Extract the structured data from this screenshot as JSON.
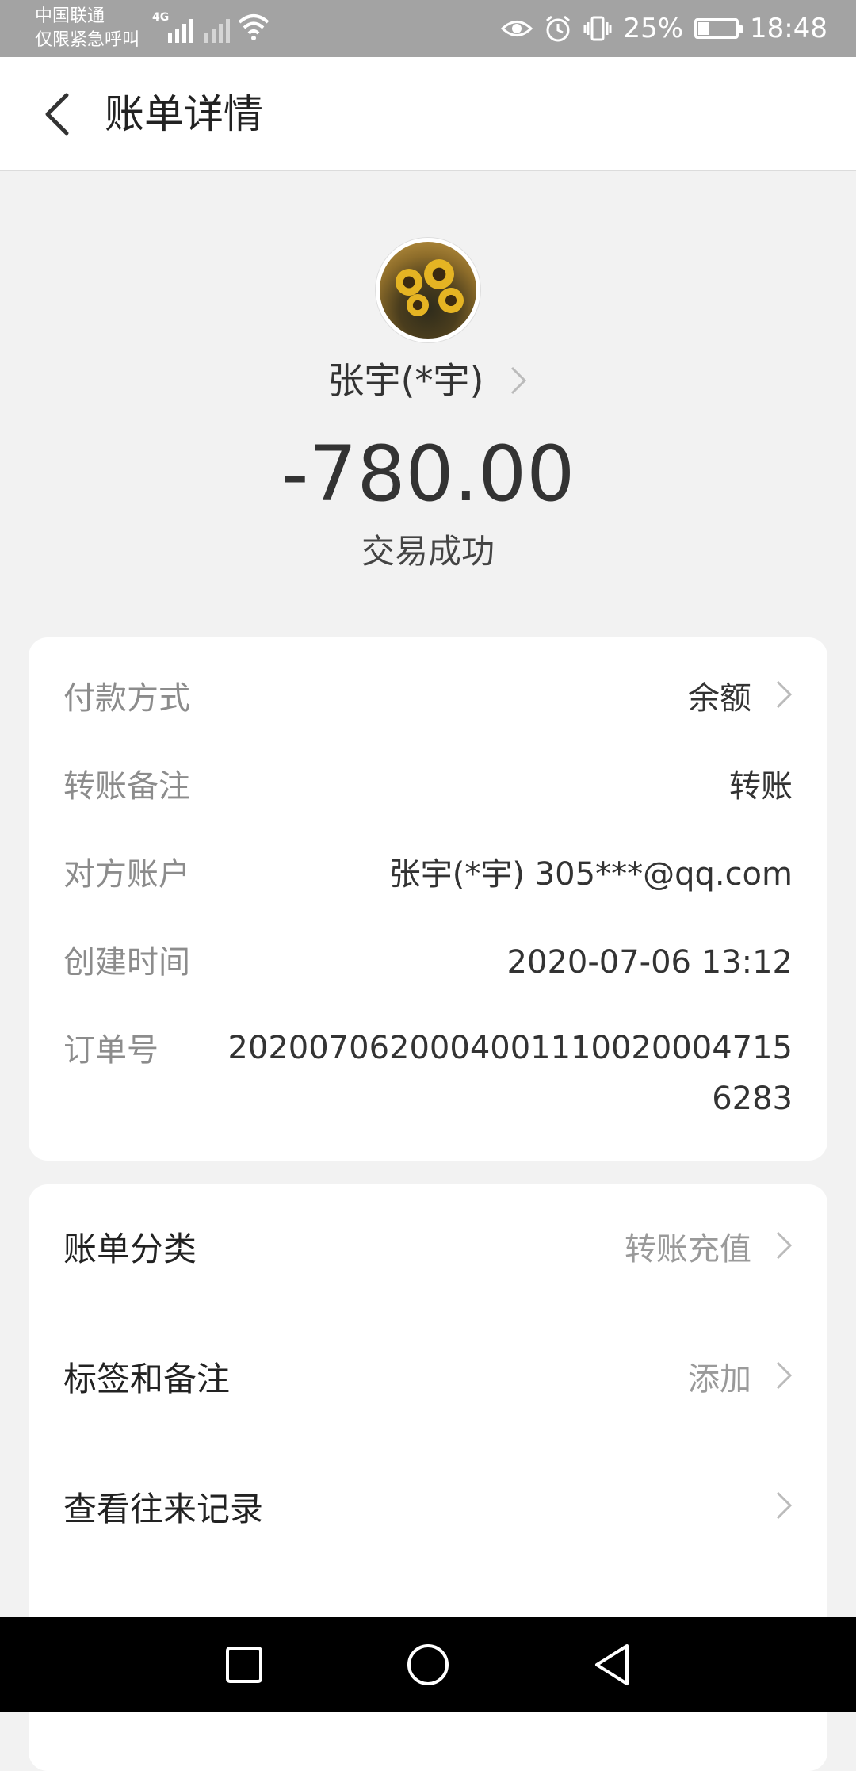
{
  "status_bar": {
    "carrier_line1": "中国联通",
    "carrier_line2": "仅限紧急呼叫",
    "network_tag": "4G",
    "battery_percent": "25%",
    "battery_level": 0.25,
    "time": "18:48",
    "icons": [
      "signal-icon",
      "no-signal-icon",
      "wifi-icon",
      "eye-icon",
      "alarm-icon",
      "vibrate-icon",
      "battery-icon"
    ]
  },
  "header": {
    "back_icon": "chevron-left-icon",
    "title": "账单详情"
  },
  "profile": {
    "name": "张宇(*宇)",
    "amount": "-780.00",
    "status": "交易成功"
  },
  "details": [
    {
      "label": "付款方式",
      "value": "余额"
    },
    {
      "label": "转账备注",
      "value": "转账"
    },
    {
      "label": "对方账户",
      "value": "张宇(*宇) 305***@qq.com"
    },
    {
      "label": "创建时间",
      "value": "2020-07-06 13:12"
    },
    {
      "label": "订单号",
      "value": "20200706200040011100200047156283"
    }
  ],
  "menu": [
    {
      "label": "账单分类",
      "value": "转账充值"
    },
    {
      "label": "标签和备注",
      "value": "添加"
    },
    {
      "label": "查看往来记录",
      "value": ""
    }
  ],
  "nav_bar": {
    "icons": [
      "recent-apps-icon",
      "home-icon",
      "back-triangle-icon"
    ]
  },
  "colors": {
    "page_bg": "#f2f2f2",
    "status_bar_bg": "#a3a3a3",
    "label_gray": "#8c8c8c",
    "text_dark": "#333333"
  }
}
